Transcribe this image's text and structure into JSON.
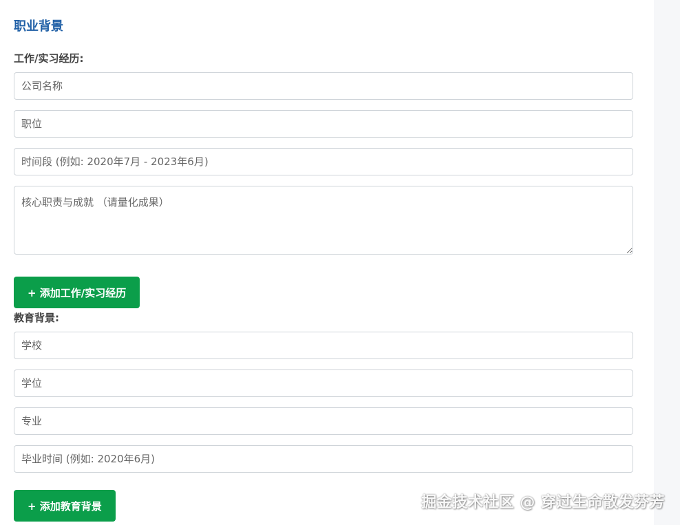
{
  "career": {
    "section_title": "职业背景",
    "work_label": "工作/实习经历:",
    "company_placeholder": "公司名称",
    "position_placeholder": "职位",
    "period_placeholder": "时间段 (例如: 2020年7月 - 2023年6月)",
    "duties_placeholder": "核心职责与成就 （请量化成果）",
    "add_work_button": "+ 添加工作/实习经历"
  },
  "education": {
    "label": "教育背景:",
    "school_placeholder": "学校",
    "degree_placeholder": "学位",
    "major_placeholder": "专业",
    "graduation_placeholder": "毕业时间 (例如: 2020年6月)",
    "add_education_button": "+ 添加教育背景"
  },
  "watermark": "掘金技术社区 @ 穿过生命散发芬芳",
  "colors": {
    "title": "#1f5fa6",
    "button": "#0b9e4a",
    "border": "#cfd4d9"
  }
}
